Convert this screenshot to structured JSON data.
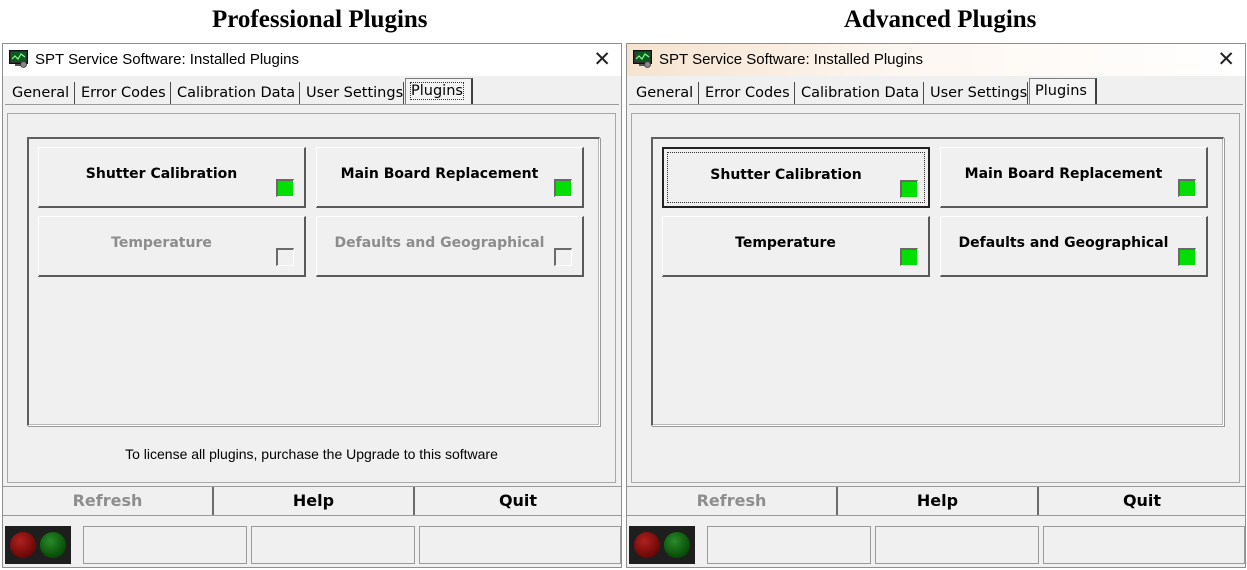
{
  "headings": [
    "Professional Plugins",
    "Advanced Plugins"
  ],
  "colors": {
    "indicator_on": "#00e000",
    "led_red": "#7a0c0c",
    "led_green": "#0d5a0d"
  },
  "windows": [
    {
      "title": "SPT Service Software: Installed Plugins",
      "close_glyph": "✕",
      "tabs": [
        "General",
        "Error Codes",
        "Calibration Data",
        "User Settings",
        "Plugins"
      ],
      "active_tab": "Plugins",
      "plugins": [
        {
          "label": "Shutter Calibration",
          "licensed": true
        },
        {
          "label": "Main Board Replacement",
          "licensed": true
        },
        {
          "label": "Temperature",
          "licensed": false
        },
        {
          "label": "Defaults and Geographical",
          "licensed": false
        }
      ],
      "note": "To license all plugins, purchase the Upgrade to this software",
      "buttons": {
        "refresh": "Refresh",
        "help": "Help",
        "quit": "Quit"
      }
    },
    {
      "title": "SPT Service Software: Installed Plugins",
      "close_glyph": "✕",
      "tabs": [
        "General",
        "Error Codes",
        "Calibration Data",
        "User Settings",
        "Plugins"
      ],
      "active_tab": "Plugins",
      "plugins": [
        {
          "label": "Shutter Calibration",
          "licensed": true
        },
        {
          "label": "Main Board Replacement",
          "licensed": true
        },
        {
          "label": "Temperature",
          "licensed": true
        },
        {
          "label": "Defaults and Geographical",
          "licensed": true
        }
      ],
      "note": "",
      "buttons": {
        "refresh": "Refresh",
        "help": "Help",
        "quit": "Quit"
      }
    }
  ]
}
